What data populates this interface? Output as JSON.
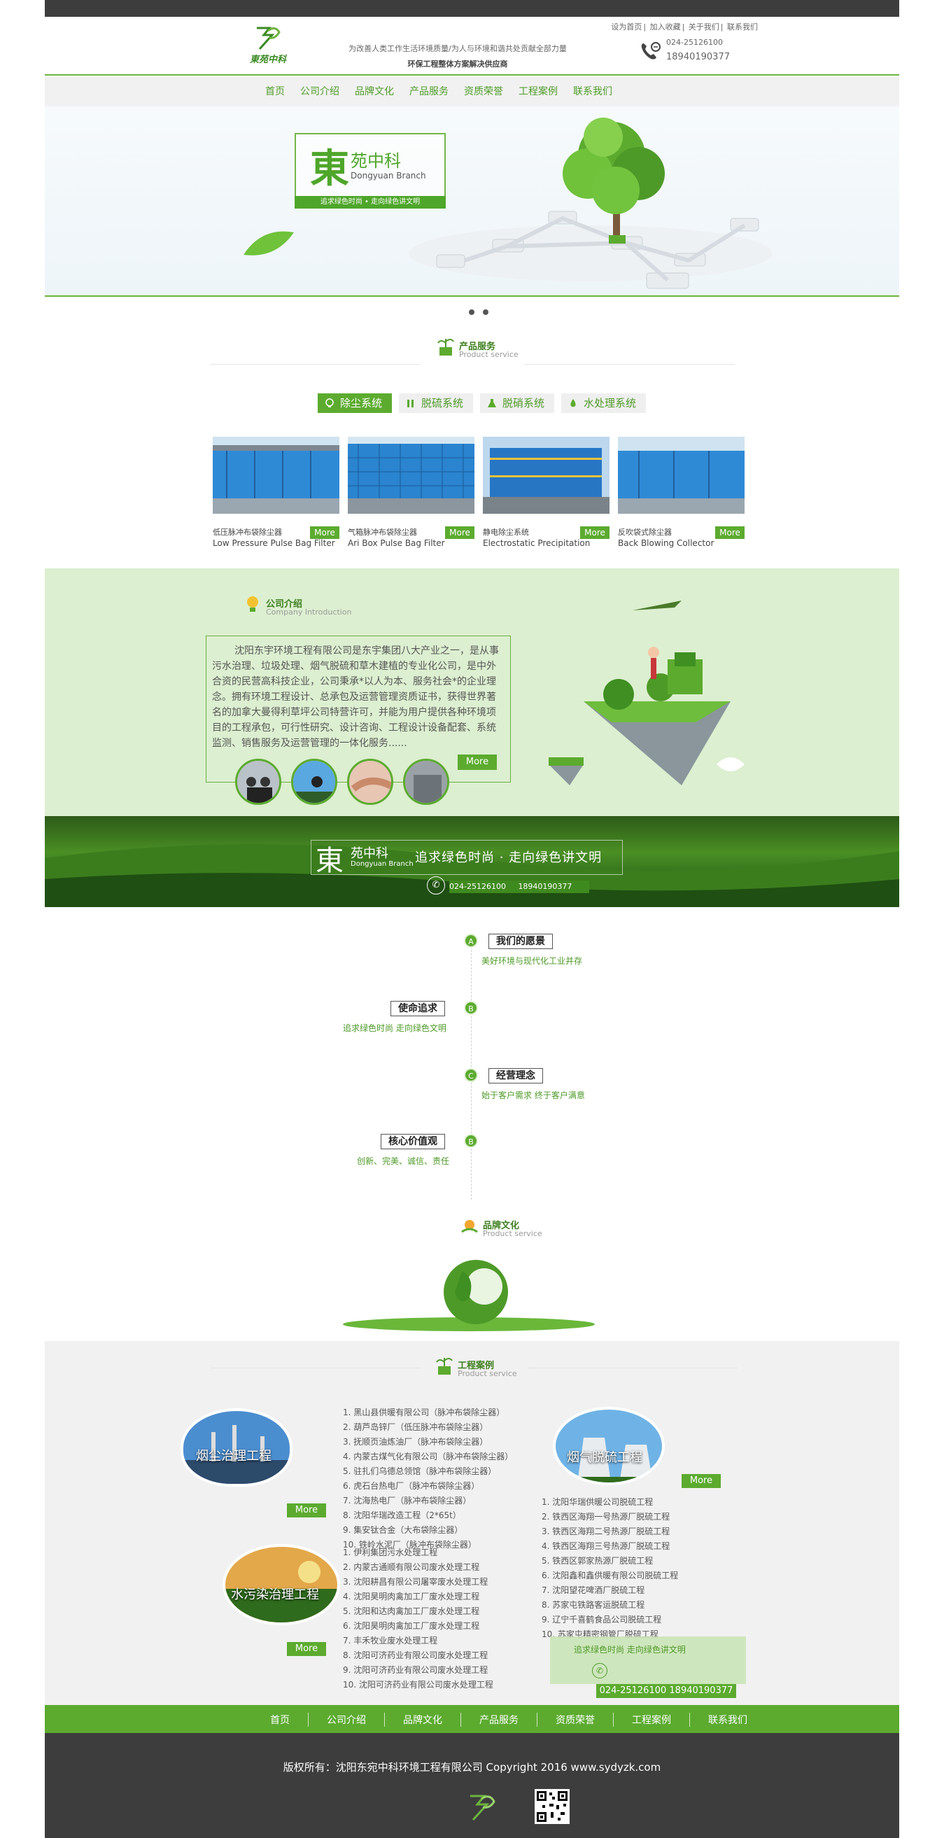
{
  "top_bar": {},
  "header": {
    "logo_text": "東苑中科",
    "top_links": [
      "设为首页",
      "加入收藏",
      "关于我们",
      "联系我们"
    ],
    "slogan_line1": "为改善人类工作生活环境质量/为人与环境和谐共处贡献全部力量",
    "slogan_line2": "环保工程整体方案解决供应商",
    "phone1": "024-25126100",
    "phone2": "18940190377"
  },
  "nav": [
    "首页",
    "公司介绍",
    "品牌文化",
    "产品服务",
    "资质荣誉",
    "工程案例",
    "联系我们"
  ],
  "banner": {
    "brand_big": "東",
    "brand_small": "苑中科",
    "brand_en": "Dongyuan Branch",
    "tagline": "追求绿色时尚 • 走向绿色讲文明"
  },
  "products_section": {
    "title": "产品服务",
    "subtitle": "Product service",
    "tabs": [
      "除尘系统",
      "脱硫系统",
      "脱硝系统",
      "水处理系统"
    ],
    "items": [
      {
        "name": "低压脉冲布袋除尘器",
        "en": "Low Pressure Pulse Bag Filter",
        "more": "More"
      },
      {
        "name": "气箱脉冲布袋除尘器",
        "en": "Ari Box Pulse Bag Filter",
        "more": "More"
      },
      {
        "name": "静电除尘系统",
        "en": "Electrostatic Precipitation",
        "more": "More"
      },
      {
        "name": "反吹袋式除尘器",
        "en": "Back Blowing Collector",
        "more": "More"
      }
    ]
  },
  "company": {
    "title": "公司介绍",
    "subtitle": "Company Introduction",
    "text": "沈阳东宇环境工程有限公司是东宇集团八大产业之一，是从事污水治理、垃圾处理、烟气脱硫和草木建植的专业化公司，是中外合资的民营高科技企业，公司秉承*以人为本、服务社会*的企业理念。拥有环境工程设计、总承包及运营管理资质证书，获得世界著名的加拿大曼得利草坪公司特营许可，并能为用户提供各种环境项目的工程承包，可行性研究、设计咨询、工程设计设备配套、系统监测、销售服务及运营管理的一体化服务......",
    "more": "More"
  },
  "strip": {
    "big": "東",
    "small": "苑中科",
    "en": "Dongyuan Branch",
    "slogan": "追求绿色时尚 · 走向绿色讲文明",
    "tel1": "024-25126100",
    "tel2": "18940190377"
  },
  "timeline": [
    {
      "node": "A",
      "title": "我们的愿景",
      "desc": "美好环境与现代化工业并存"
    },
    {
      "node": "B",
      "title": "使命追求",
      "desc": "追求绿色时尚  走向绿色文明"
    },
    {
      "node": "C",
      "title": "经营理念",
      "desc": "始于客户需求 终于客户满意"
    },
    {
      "node": "B",
      "title": "核心价值观",
      "desc": "创新、完美、诚信、责任"
    }
  ],
  "brand_section": {
    "title": "品牌文化",
    "subtitle": "Product service"
  },
  "cases_section": {
    "title": "工程案例",
    "subtitle": "Product service",
    "dust": {
      "label": "烟尘治理工程",
      "more": "More",
      "items": [
        "黑山县供暖有限公司（脉冲布袋除尘器）",
        "葫芦岛锌厂（低压脉冲布袋除尘器）",
        "抚顺页油炼油厂（脉冲布袋除尘器）",
        "内蒙古煤气化有限公司（脉冲布袋除尘器）",
        "驻扎们乌德总领馆（脉冲布袋除尘器）",
        "虎石台热电厂（脉冲布袋除尘器）",
        "沈海热电厂（脉冲布袋除尘器）",
        "沈阳华瑞改造工程（2*65t）",
        "集安钛合金（大布袋除尘器）",
        "铁岭水泥厂（脉冲布袋除尘器）"
      ]
    },
    "water": {
      "label": "水污染治理工程",
      "more": "More",
      "items": [
        "伊利集团污水处理工程",
        "内蒙古通顺有限公司废水处理工程",
        "沈阳耕昌有限公司屠宰废水处理工程",
        "沈阳昊明肉禽加工厂废水处理工程",
        "沈阳和达肉禽加工厂废水处理工程",
        "沈阳昊明肉禽加工厂废水处理工程",
        "丰禾牧业废水处理工程",
        "沈阳可济药业有限公司废水处理工程",
        "沈阳可济药业有限公司废水处理工程",
        "沈阳可济药业有限公司废水处理工程"
      ]
    },
    "flue": {
      "label": "烟气脱硫工程",
      "more": "More",
      "items": [
        "沈阳华瑞供暖公司脱硫工程",
        "铁西区海翔一号热源厂脱硫工程",
        "铁西区海翔二号热源厂脱硫工程",
        "铁西区海翔三号热源厂脱硫工程",
        "铁西区郭家热源厂脱硫工程",
        "沈阳鑫和鑫供暖有限公司脱硫工程",
        "沈阳望花啤酒厂脱硫工程",
        "苏家屯铁路客运脱硫工程",
        "辽宁千喜鹤食品公司脱硫工程",
        "苏家屯精密钢管厂脱硫工程"
      ]
    },
    "cta_text": "追求绿色时尚   走向绿色讲文明",
    "cta_tel": "024-25126100   18940190377"
  },
  "footer_nav": [
    "首页",
    "公司介绍",
    "品牌文化",
    "产品服务",
    "资质荣誉",
    "工程案例",
    "联系我们"
  ],
  "footer": {
    "copyright": "版权所有：沈阳东宛中科环境工程有限公司 Copyright   2016   www.sydyzk.com"
  },
  "colors": {
    "green": "#5cab2f",
    "dark": "#3d3d3d",
    "light_green": "#dcefd0"
  }
}
